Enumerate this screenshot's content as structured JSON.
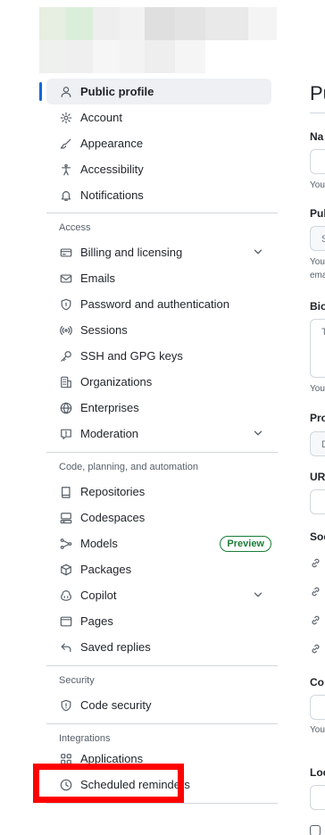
{
  "blurred_header": {
    "row1": [
      "#e6efe2",
      "#dbeeda",
      "#eeeeee",
      "#f2f2f2",
      "#dfdfdf",
      "#e3e3e3",
      "#e9e9e9",
      "#f4f4f4"
    ],
    "row2": [
      "#eef1ee",
      "#efefef",
      "#f6f6f6",
      "#f3f3f3",
      "#eeeeee",
      "#f5f5f5",
      "#ffffff",
      "#ffffff"
    ]
  },
  "sidebar": {
    "primary": [
      {
        "label": "Public profile",
        "icon": "person-icon",
        "active": true
      },
      {
        "label": "Account",
        "icon": "gear-icon"
      },
      {
        "label": "Appearance",
        "icon": "paintbrush-icon"
      },
      {
        "label": "Accessibility",
        "icon": "accessibility-icon"
      },
      {
        "label": "Notifications",
        "icon": "bell-icon"
      }
    ],
    "access": {
      "title": "Access",
      "items": [
        {
          "label": "Billing and licensing",
          "icon": "credit-card-icon",
          "expandable": true
        },
        {
          "label": "Emails",
          "icon": "mail-icon"
        },
        {
          "label": "Password and authentication",
          "icon": "shield-lock-icon"
        },
        {
          "label": "Sessions",
          "icon": "broadcast-icon"
        },
        {
          "label": "SSH and GPG keys",
          "icon": "key-icon"
        },
        {
          "label": "Organizations",
          "icon": "organization-icon"
        },
        {
          "label": "Enterprises",
          "icon": "globe-icon"
        },
        {
          "label": "Moderation",
          "icon": "report-icon",
          "expandable": true
        }
      ]
    },
    "code": {
      "title": "Code, planning, and automation",
      "items": [
        {
          "label": "Repositories",
          "icon": "repo-icon"
        },
        {
          "label": "Codespaces",
          "icon": "codespaces-icon"
        },
        {
          "label": "Models",
          "icon": "models-icon",
          "badge": "Preview"
        },
        {
          "label": "Packages",
          "icon": "package-icon"
        },
        {
          "label": "Copilot",
          "icon": "copilot-icon",
          "expandable": true
        },
        {
          "label": "Pages",
          "icon": "browser-icon"
        },
        {
          "label": "Saved replies",
          "icon": "reply-icon"
        }
      ]
    },
    "security": {
      "title": "Security",
      "items": [
        {
          "label": "Code security",
          "icon": "shield-icon"
        }
      ]
    },
    "integrations": {
      "title": "Integrations",
      "items": [
        {
          "label": "Applications",
          "icon": "apps-icon",
          "highlighted": true
        },
        {
          "label": "Scheduled reminders",
          "icon": "clock-icon"
        }
      ]
    }
  },
  "main": {
    "heading": "Pu",
    "fields": [
      {
        "label": "Na",
        "help": "You"
      },
      {
        "label": "Pul",
        "placeholder": "S",
        "help": "You",
        "help2": "ema"
      },
      {
        "label": "Bio",
        "placeholder": "T",
        "help": "You"
      },
      {
        "label": "Pro",
        "placeholder": "D"
      },
      {
        "label": "UR"
      },
      {
        "label": "Soc"
      },
      {
        "label": "Co",
        "help": "You"
      },
      {
        "label": "Loc"
      }
    ]
  },
  "colors": {
    "accent": "#0969da",
    "highlight": "#ff0000",
    "badge": "#1a7f37"
  }
}
